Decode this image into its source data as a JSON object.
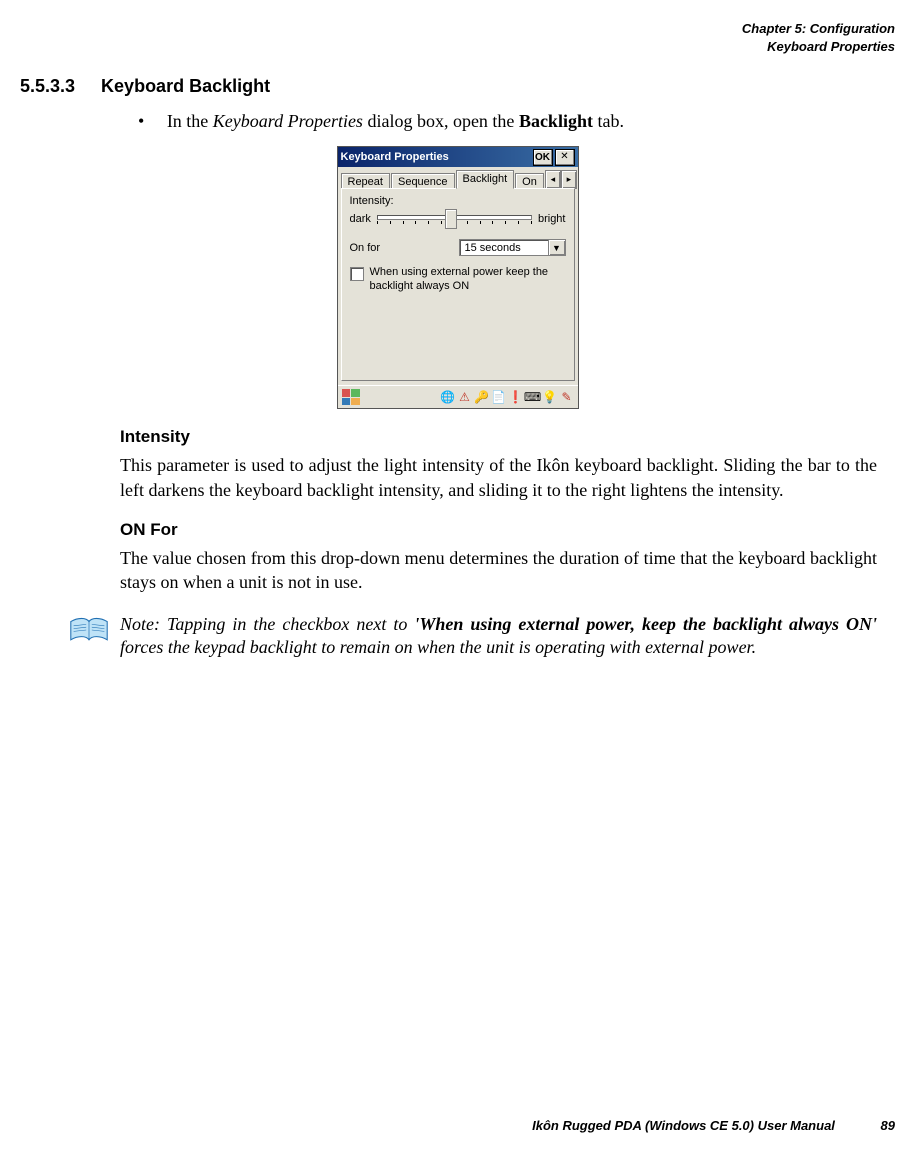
{
  "running_head": {
    "line1": "Chapter 5: Configuration",
    "line2": "Keyboard Properties"
  },
  "section": {
    "number": "5.5.3.3",
    "title": "Keyboard Backlight"
  },
  "bullet": {
    "pre": "In the ",
    "em": "Keyboard Properties",
    "mid": " dialog box, open the ",
    "bold": "Backlight",
    "post": " tab."
  },
  "dialog": {
    "title": "Keyboard Properties",
    "ok": "OK",
    "tabs": {
      "repeat": "Repeat",
      "sequence": "Sequence",
      "backlight": "Backlight",
      "partial": "On"
    },
    "intensity_label": "Intensity:",
    "slider_left": "dark",
    "slider_right": "bright",
    "onfor_label": "On for",
    "onfor_value": "15 seconds",
    "check_text": "When using external power keep the backlight always ON"
  },
  "intensity_heading": "Intensity",
  "intensity_body": "This parameter is used to adjust the light intensity of the Ikôn keyboard backlight. Sliding the bar to the left darkens the keyboard backlight intensity, and sliding it to the right lightens the intensity.",
  "onfor_heading": "ON For",
  "onfor_body": "The value chosen from this drop-down menu determines the duration of time that the keyboard backlight stays on when a unit is not in use.",
  "note": {
    "lead": "Note: Tapping in the checkbox next to ",
    "bold": "'When using external power, keep the backlight always ON'",
    "tail": " forces the keypad backlight to remain on when the unit is operating with external power."
  },
  "footer": {
    "text": "Ikôn Rugged PDA (Windows CE 5.0) User Manual",
    "page": "89"
  }
}
